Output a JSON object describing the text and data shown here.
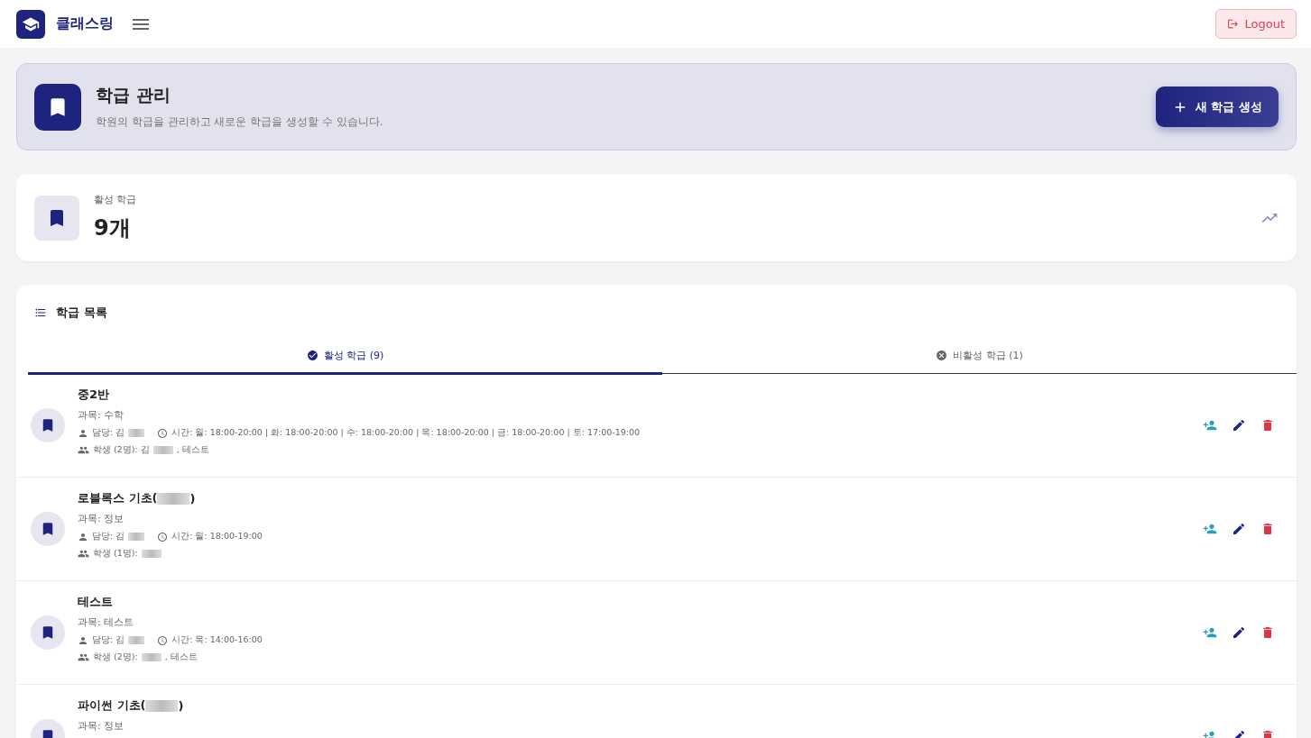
{
  "header": {
    "brand": "클래스링",
    "logout": "Logout"
  },
  "banner": {
    "title": "학급 관리",
    "subtitle": "학원의 학급을 관리하고 새로운 학급을 생성할 수 있습니다.",
    "create_button": "새 학급 생성"
  },
  "stat": {
    "label": "활성 학급",
    "value": "9개"
  },
  "list": {
    "title": "학급 목록",
    "tabs": [
      {
        "label": "활성 학급 (9)",
        "selected": true
      },
      {
        "label": "비활성 학급 (1)",
        "selected": false
      }
    ],
    "rows": [
      {
        "title": [
          {
            "kind": "text",
            "text": "중2반"
          }
        ],
        "subject": "과목: 수학",
        "teacher": [
          {
            "kind": "text",
            "text": "담당: 김"
          },
          {
            "kind": "redacted"
          }
        ],
        "schedule": "시간: 월: 18:00-20:00 | 화: 18:00-20:00 | 수: 18:00-20:00 | 목: 18:00-20:00 | 금: 18:00-20:00 | 토: 17:00-19:00",
        "students": [
          {
            "kind": "text",
            "text": "학생 (2명): 김"
          },
          {
            "kind": "redacted"
          },
          {
            "kind": "text",
            "text": ", 테스트"
          }
        ]
      },
      {
        "title": [
          {
            "kind": "text",
            "text": "로블록스 기초("
          },
          {
            "kind": "redacted"
          },
          {
            "kind": "text",
            "text": ")"
          }
        ],
        "subject": "과목: 정보",
        "teacher": [
          {
            "kind": "text",
            "text": "담당: 김"
          },
          {
            "kind": "redacted"
          }
        ],
        "schedule": "시간: 월: 18:00-19:00",
        "students": [
          {
            "kind": "text",
            "text": "학생 (1명):"
          },
          {
            "kind": "redacted"
          }
        ]
      },
      {
        "title": [
          {
            "kind": "text",
            "text": "테스트"
          }
        ],
        "subject": "과목: 테스트",
        "teacher": [
          {
            "kind": "text",
            "text": "담당: 김"
          },
          {
            "kind": "redacted"
          }
        ],
        "schedule": "시간: 목: 14:00-16:00",
        "students": [
          {
            "kind": "text",
            "text": "학생 (2명):"
          },
          {
            "kind": "redacted"
          },
          {
            "kind": "text",
            "text": ", 테스트"
          }
        ]
      },
      {
        "title": [
          {
            "kind": "text",
            "text": "파이썬 기초("
          },
          {
            "kind": "redacted"
          },
          {
            "kind": "text",
            "text": ")"
          }
        ],
        "subject": "과목: 정보"
      }
    ]
  }
}
